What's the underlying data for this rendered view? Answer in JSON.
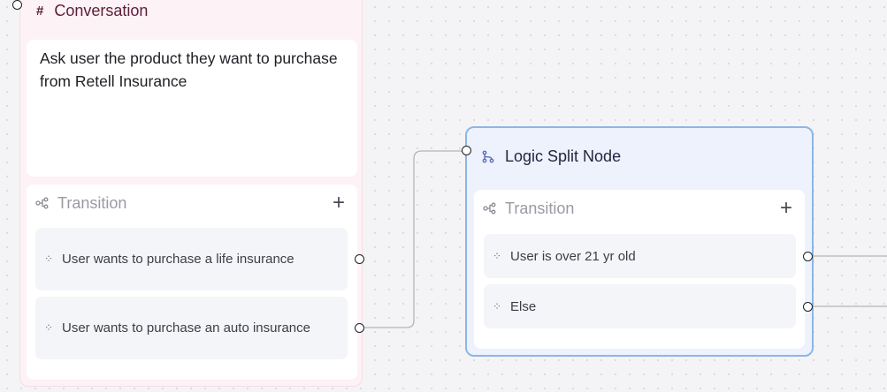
{
  "conversation_node": {
    "type_label": "Conversation",
    "prompt": "Ask user the product they want to purchase from Retell Insurance",
    "transition": {
      "label": "Transition",
      "add_symbol": "+",
      "conditions": [
        "User wants to purchase a life insurance",
        "User wants to purchase an auto insurance"
      ]
    }
  },
  "logic_split_node": {
    "title": "Logic Split Node",
    "transition": {
      "label": "Transition",
      "add_symbol": "+",
      "conditions": [
        "User is over 21 yr old",
        "Else"
      ]
    }
  },
  "icons": {
    "conversation": "hash-icon",
    "transition": "branch-icon",
    "condition": "sparkle-icon",
    "logic": "split-icon"
  },
  "colors": {
    "conversation_bg": "#fdf2f5",
    "logic_bg": "#eef2fd",
    "logic_border": "#8db6e6",
    "edge": "#b3b3ba"
  }
}
